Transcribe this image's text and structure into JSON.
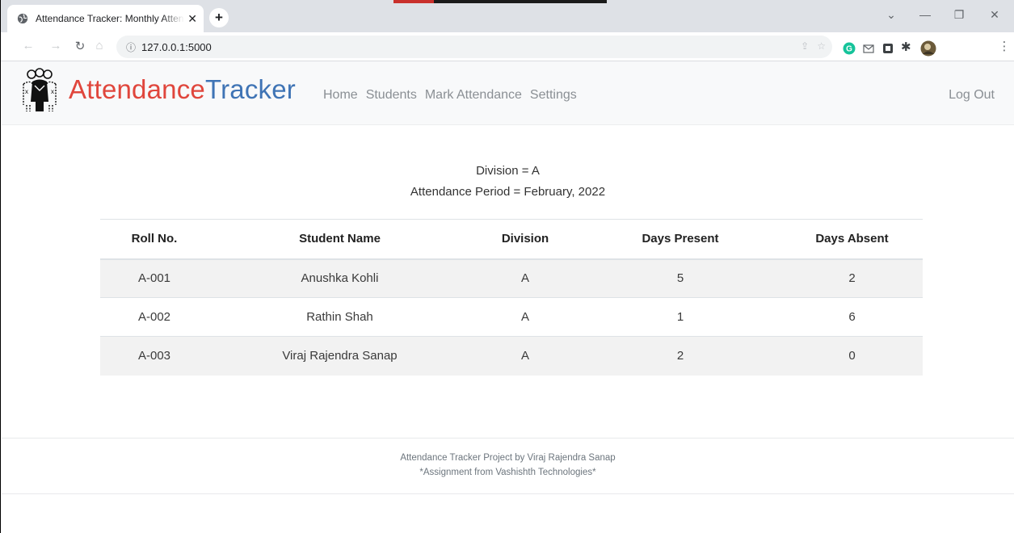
{
  "browser": {
    "tab_title": "Attendance Tracker: Monthly Attendance",
    "url": "127.0.0.1:5000"
  },
  "navbar": {
    "brand_part1": "Attendance",
    "brand_part2": "Tracker",
    "links": [
      "Home",
      "Students",
      "Mark Attendance",
      "Settings"
    ],
    "logout": "Log Out"
  },
  "report": {
    "division_line": "Division = A",
    "period_line": "Attendance Period = February, 2022"
  },
  "table": {
    "headers": [
      "Roll No.",
      "Student Name",
      "Division",
      "Days Present",
      "Days Absent"
    ],
    "rows": [
      [
        "A-001",
        "Anushka Kohli",
        "A",
        "5",
        "2"
      ],
      [
        "A-002",
        "Rathin Shah",
        "A",
        "1",
        "6"
      ],
      [
        "A-003",
        "Viraj Rajendra Sanap",
        "A",
        "2",
        "0"
      ]
    ]
  },
  "footer": {
    "line1": "Attendance Tracker Project by Viraj Rajendra Sanap",
    "line2": "*Assignment from Vashishth Technologies*"
  },
  "colors": {
    "brand_red": "#e0463c",
    "brand_blue": "#3f74b5"
  }
}
